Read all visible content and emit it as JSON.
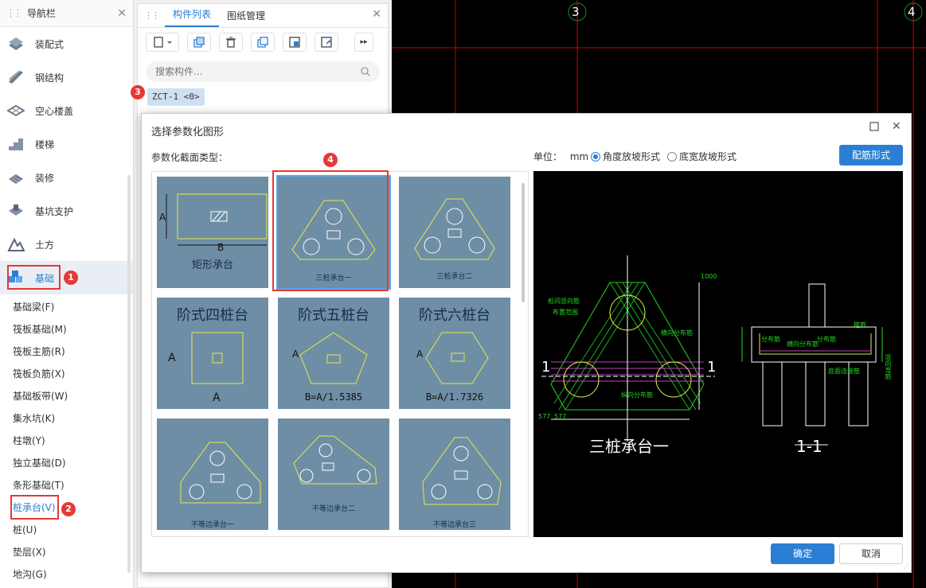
{
  "nav": {
    "title": "导航栏",
    "categories": [
      {
        "label": "装配式",
        "icon": "prefab-icon"
      },
      {
        "label": "钢结构",
        "icon": "steel-beam-icon"
      },
      {
        "label": "空心楼盖",
        "icon": "hollow-slab-icon"
      },
      {
        "label": "楼梯",
        "icon": "stairs-icon"
      },
      {
        "label": "装修",
        "icon": "decoration-icon"
      },
      {
        "label": "基坑支护",
        "icon": "foundation-pit-icon"
      },
      {
        "label": "土方",
        "icon": "earthwork-icon"
      },
      {
        "label": "基础",
        "icon": "foundation-icon"
      }
    ],
    "subitems": [
      "基础梁(F)",
      "筏板基础(M)",
      "筏板主筋(R)",
      "筏板负筋(X)",
      "基础板带(W)",
      "集水坑(K)",
      "柱墩(Y)",
      "独立基础(D)",
      "条形基础(T)",
      "桩承台(V)",
      "桩(U)",
      "垫层(X)",
      "地沟(G)"
    ]
  },
  "component_panel": {
    "tabs": [
      "构件列表",
      "图纸管理"
    ],
    "search_placeholder": "搜索构件...",
    "selected_item": "ZCT-1 <0>"
  },
  "cad": {
    "axis_labels": [
      "3",
      "4"
    ]
  },
  "badges": [
    "1",
    "2",
    "3",
    "4"
  ],
  "dialog": {
    "title": "选择参数化图形",
    "section_label": "参数化截面类型：",
    "unit_label": "单位：",
    "unit_value": "mm",
    "radio_angle": "角度放坡形式",
    "radio_width": "底宽放坡形式",
    "rebar_button": "配筋形式",
    "ok_button": "确定",
    "cancel_button": "取消",
    "shapes": [
      {
        "caption": "矩形承台",
        "dim_a": "A",
        "dim_b": "B"
      },
      {
        "caption": "三桩承台一"
      },
      {
        "caption": "三桩承台二"
      },
      {
        "caption": "阶式四桩台",
        "dim_a": "A",
        "dim_b": "A"
      },
      {
        "caption": "阶式五桩台",
        "dim_a": "A",
        "formula": "B=A/1.5385"
      },
      {
        "caption": "阶式六桩台",
        "dim_a": "A",
        "formula": "B=A/1.7326"
      },
      {
        "caption": "不等边承台一"
      },
      {
        "caption": "不等边承台二"
      },
      {
        "caption": "不等边承台三"
      }
    ],
    "preview": {
      "title": "三桩承台一",
      "section": "1-1",
      "marks": [
        "1",
        "1"
      ],
      "dims": [
        "577",
        "577",
        "1000"
      ],
      "annotations": [
        "桩间竖向筋",
        "布置范围",
        "横向分布筋",
        "纵向分布筋",
        "分布筋",
        "横向分布筋",
        "底面连接筋",
        "分布筋",
        "竖向弯筋",
        "箍筋"
      ]
    }
  }
}
